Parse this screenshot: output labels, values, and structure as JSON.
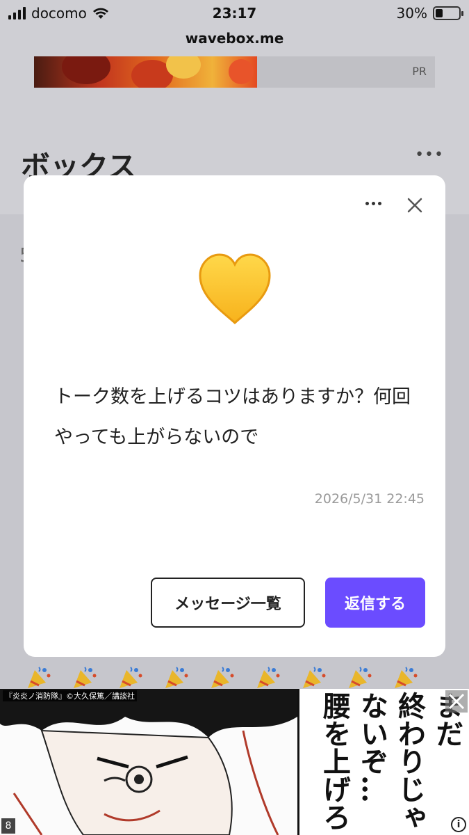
{
  "status_bar": {
    "carrier": "docomo",
    "time": "23:17",
    "battery_percent_label": "30%",
    "battery_level": 0.3
  },
  "url_bar": {
    "domain": "wavebox.me"
  },
  "top_ad": {
    "pr_label": "PR"
  },
  "background_page": {
    "title": "ボックス",
    "more_label": "•••",
    "partial_text": "5"
  },
  "modal": {
    "emoji_icon": "yellow-heart-icon",
    "message": "トーク数を上げるコツはありますか？何回やっても上がらないので",
    "timestamp": "2026/5/31 22:45",
    "list_button_label": "メッセージ一覧",
    "reply_button_label": "返信する",
    "accent_color": "#6b4cff"
  },
  "bottom_ad": {
    "credit": "『炎炎ノ消防隊』©大久保篤／講談社",
    "columns": [
      "まだ",
      "終わりじゃ",
      "ないぞ…",
      "腰を上げろ"
    ],
    "info_label": "i",
    "corner_number": "8"
  }
}
